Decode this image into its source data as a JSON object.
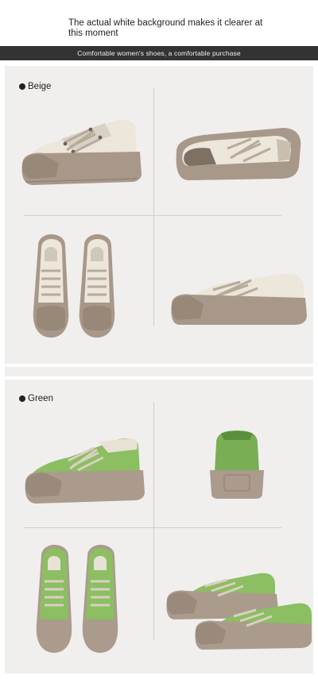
{
  "header": {
    "caption": "The actual white background makes it clearer at this moment"
  },
  "banner": {
    "text": "Comfortable women's shoes, a comfortable purchase"
  },
  "sections": [
    {
      "label": "Beige",
      "upper_color": "#ece6db",
      "sole_color": "#a8988a"
    },
    {
      "label": "Green",
      "upper_color": "#8cbe62",
      "sole_color": "#aa9b8d"
    }
  ]
}
